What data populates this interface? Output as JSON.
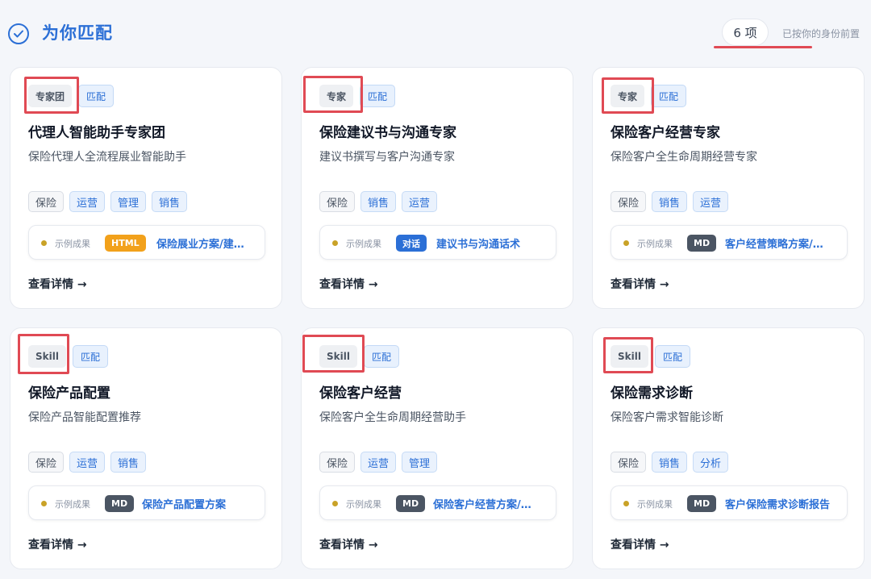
{
  "header": {
    "title": "为你匹配",
    "count": "6 项",
    "hint": "已按你的身份前置"
  },
  "colors": {
    "accent": "#2b6fd6",
    "highlight_red": "#e04a54",
    "html_badge": "#f2a11b",
    "dialog_badge": "#2b6fd6",
    "md_badge": "#4b5563",
    "example_dot": "#c9a227"
  },
  "icons": {
    "header": "check-circle-icon",
    "arrow": "arrow-right-icon"
  },
  "cards": [
    {
      "type": "专家团",
      "match": "匹配",
      "title": "代理人智能助手专家团",
      "desc": "保险代理人全流程展业智能助手",
      "tags": [
        "保险",
        "运营",
        "管理",
        "销售"
      ],
      "example_label": "示例成果",
      "format": "HTML",
      "format_color": "#f2a11b",
      "link": "保险展业方案/建议书等",
      "details": "查看详情 →"
    },
    {
      "type": "专家",
      "match": "匹配",
      "title": "保险建议书与沟通专家",
      "desc": "建议书撰写与客户沟通专家",
      "tags": [
        "保险",
        "销售",
        "运营"
      ],
      "example_label": "示例成果",
      "format": "对话",
      "format_color": "#2b6fd6",
      "link": "建议书与沟通话术",
      "details": "查看详情 →"
    },
    {
      "type": "专家",
      "match": "匹配",
      "title": "保险客户经营专家",
      "desc": "保险客户全生命周期经营专家",
      "tags": [
        "保险",
        "销售",
        "运营"
      ],
      "example_label": "示例成果",
      "format": "MD",
      "format_color": "#4b5563",
      "link": "客户经营策略方案/话术",
      "details": "查看详情 →"
    },
    {
      "type": "Skill",
      "match": "匹配",
      "title": "保险产品配置",
      "desc": "保险产品智能配置推荐",
      "tags": [
        "保险",
        "运营",
        "销售"
      ],
      "example_label": "示例成果",
      "format": "MD",
      "format_color": "#4b5563",
      "link": "保险产品配置方案",
      "details": "查看详情 →"
    },
    {
      "type": "Skill",
      "match": "匹配",
      "title": "保险客户经营",
      "desc": "保险客户全生命周期经营助手",
      "tags": [
        "保险",
        "运营",
        "管理"
      ],
      "example_label": "示例成果",
      "format": "MD",
      "format_color": "#4b5563",
      "link": "保险客户经营方案/话术",
      "details": "查看详情 →"
    },
    {
      "type": "Skill",
      "match": "匹配",
      "title": "保险需求诊断",
      "desc": "保险客户需求智能诊断",
      "tags": [
        "保险",
        "销售",
        "分析"
      ],
      "example_label": "示例成果",
      "format": "MD",
      "format_color": "#4b5563",
      "link": "客户保险需求诊断报告",
      "details": "查看详情 →"
    }
  ]
}
